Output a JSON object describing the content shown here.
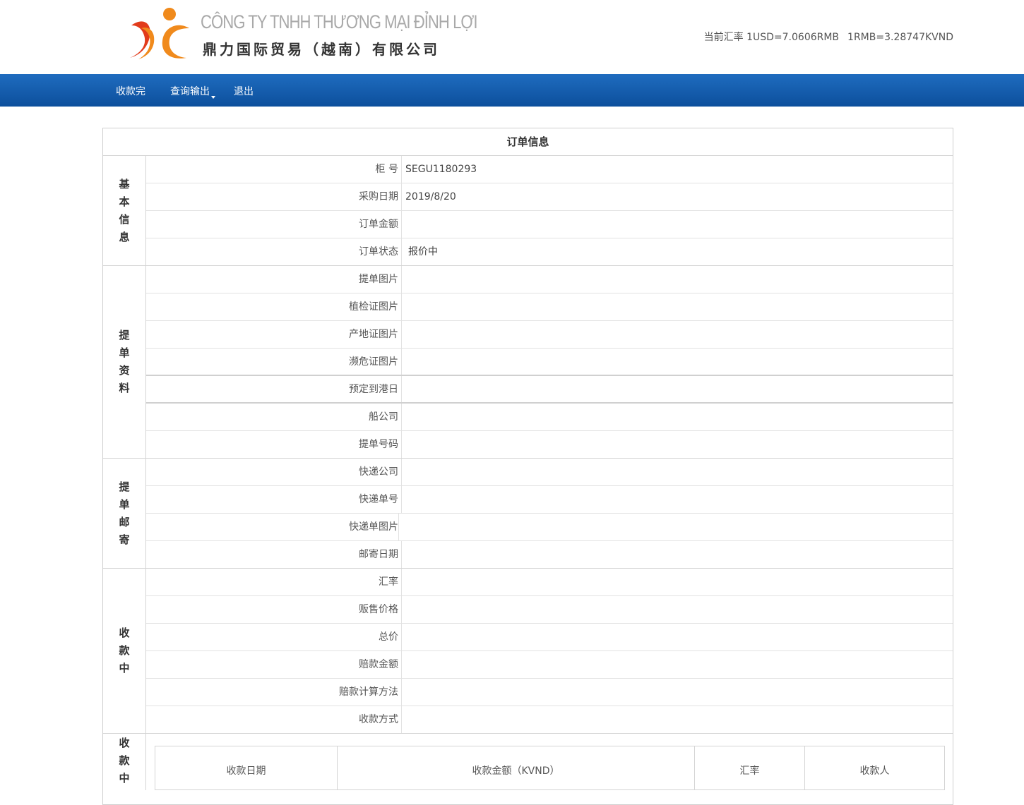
{
  "company": {
    "name_vn": "CÔNG TY TNHH THƯƠNG MẠI ĐỈNH LỢI",
    "name_cn": "鼎力国际贸易（越南）有限公司"
  },
  "exchange_rate": {
    "usd": "当前汇率 1USD=7.0606RMB",
    "rmb": "1RMB=3.28747KVND"
  },
  "nav": [
    {
      "label": "收款完"
    },
    {
      "label": "查询输出"
    },
    {
      "label": "退出"
    }
  ],
  "panel_title": "订单信息",
  "groups": {
    "basic": {
      "label_chars": [
        "基",
        "本",
        "信",
        "息"
      ],
      "rows": [
        {
          "label": "柜 号",
          "value": "SEGU1180293"
        },
        {
          "label": "采购日期",
          "value": "2019/8/20"
        },
        {
          "label": "订单金额",
          "value": ""
        },
        {
          "label": "订单状态",
          "value": "报价中"
        }
      ]
    },
    "bill": {
      "label_chars": [
        "提",
        "单",
        "资",
        "料"
      ],
      "rows": [
        {
          "label": "提单图片",
          "value": ""
        },
        {
          "label": "植检证图片",
          "value": ""
        },
        {
          "label": "产地证图片",
          "value": ""
        },
        {
          "label": "濒危证图片",
          "value": ""
        },
        {
          "label": "预定到港日",
          "value": ""
        },
        {
          "label": "船公司",
          "value": ""
        },
        {
          "label": "提单号码",
          "value": ""
        }
      ]
    },
    "mail": {
      "label_chars": [
        "提",
        "单",
        "邮",
        "寄"
      ],
      "rows": [
        {
          "label": "快递公司",
          "value": ""
        },
        {
          "label": "快递单号",
          "value": ""
        },
        {
          "label": "快递单图片",
          "value": ""
        },
        {
          "label": "邮寄日期",
          "value": ""
        }
      ]
    },
    "collecting": {
      "label_chars": [
        "收",
        "款",
        "中"
      ],
      "rows": [
        {
          "label": "汇率",
          "value": ""
        },
        {
          "label": "贩售价格",
          "value": ""
        },
        {
          "label": "总价",
          "value": ""
        },
        {
          "label": "赔款金额",
          "value": ""
        },
        {
          "label": "赔款计算方法",
          "value": ""
        },
        {
          "label": "收款方式",
          "value": ""
        }
      ]
    },
    "payment": {
      "label_chars": [
        "收",
        "款",
        "中"
      ],
      "columns": [
        "收款日期",
        "收款金额（KVND）",
        "汇率",
        "收款人"
      ]
    }
  },
  "colors": {
    "nav_top": "#1f6cbf",
    "nav_bottom": "#0c4f9c",
    "logo_orange": "#f08a1c",
    "logo_red": "#e23b1b"
  }
}
